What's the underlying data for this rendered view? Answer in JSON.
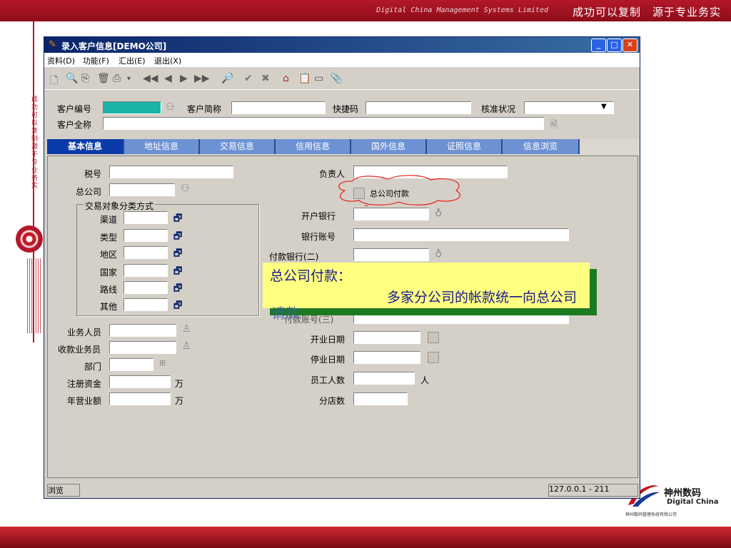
{
  "banner": {
    "english": "Digital China Management Systems Limited",
    "slogan": "成功可以复制　源于专业务实"
  },
  "side_slogan": "成功可以复制·源于专业务实",
  "logo": {
    "cn": "神州数码",
    "en": "Digital China",
    "company": "神州数码管理系统有限公司"
  },
  "window": {
    "title": "录入客户信息[DEMO公司]",
    "buttons": {
      "minimize": "_",
      "maximize": "□",
      "close": "✕"
    },
    "menu": [
      "资料(D)",
      "功能(F)",
      "汇出(E)",
      "退出(X)"
    ],
    "toolbar_icons": [
      "new-icon",
      "preview-icon",
      "copy-icon",
      "delete-icon",
      "print-icon",
      "print-dropdown-icon",
      "first-icon",
      "prev-icon",
      "next-icon",
      "last-icon",
      "find-icon",
      "confirm-icon",
      "cancel-icon",
      "home-icon",
      "paste-icon",
      "clipboard-icon",
      "attach-icon"
    ],
    "header": {
      "customer_no_label": "客户编号",
      "customer_no_value": "",
      "short_name_label": "客户简称",
      "quick_code_label": "快捷码",
      "approval_label": "核准状况",
      "approval_value": "",
      "full_name_label": "客户全称"
    },
    "tabs": [
      "基本信息",
      "地址信息",
      "交易信息",
      "信用信息",
      "国外信息",
      "证照信息",
      "信息浏览"
    ],
    "active_tab": 0,
    "left_fields": {
      "tax_no": "税号",
      "head_office": "总公司",
      "group_title": "交易对象分类方式",
      "channel": "渠道",
      "type": "类型",
      "region": "地区",
      "country": "国家",
      "route": "路线",
      "other": "其他",
      "salesperson": "业务人员",
      "collector": "收款业务员",
      "department": "部门",
      "capital": "注册资金",
      "revenue": "年营业额",
      "unit_wan": "万"
    },
    "right_fields": {
      "principal": "负责人",
      "head_office_pay": "总公司付款",
      "bank": "开户银行",
      "bank_account": "银行账号",
      "pay_bank2": "付款银行(二)",
      "pay_account3": "付款账号(三)",
      "open_date": "开业日期",
      "close_date": "停业日期",
      "employees": "员工人数",
      "unit_person": "人",
      "branches": "分店数"
    },
    "status": {
      "left": "浏览",
      "right": "127.0.0.1 - 211"
    }
  },
  "callout": {
    "title": "总公司付款：",
    "body": "多家分公司的帐款统一向总公司",
    "ghost": "请款"
  }
}
